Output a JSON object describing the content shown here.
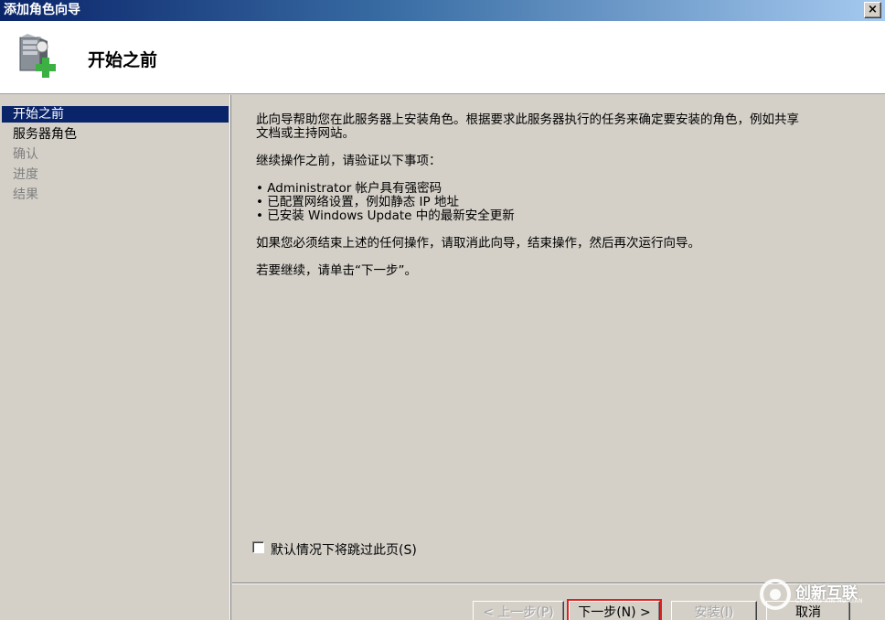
{
  "window": {
    "title": "添加角色向导",
    "close_label": "×"
  },
  "header": {
    "title": "开始之前",
    "icon": "server-add-icon"
  },
  "sidebar": {
    "items": [
      {
        "label": "开始之前",
        "state": "active"
      },
      {
        "label": "服务器角色",
        "state": "enabled"
      },
      {
        "label": "确认",
        "state": "disabled"
      },
      {
        "label": "进度",
        "state": "disabled"
      },
      {
        "label": "结果",
        "state": "disabled"
      }
    ]
  },
  "content": {
    "intro_line1": "此向导帮助您在此服务器上安装角色。根据要求此服务器执行的任务来确定要安装的角色，例如共享",
    "intro_line2": "文档或主持网站。",
    "verify_heading": "继续操作之前，请验证以下事项：",
    "bullets": [
      "• Administrator 帐户具有强密码",
      "• 已配置网络设置，例如静态 IP 地址",
      "• 已安装 Windows Update 中的最新安全更新"
    ],
    "cancel_note": "如果您必须结束上述的任何操作，请取消此向导，结束操作，然后再次运行向导。",
    "continue_note": "若要继续，请单击“下一步”。",
    "skip_checkbox_label": "默认情况下将跳过此页(S)"
  },
  "buttons": {
    "prev": "< 上一步(P)",
    "next": "下一步(N) >",
    "install": "安装(I)",
    "cancel": "取消"
  },
  "watermark": {
    "brand": "创新互联",
    "sub": "CHUANG XIN HU LIAN"
  },
  "colors": {
    "titlebar_start": "#0a246a",
    "titlebar_end": "#a6caf0",
    "selection": "#0a246a",
    "next_highlight": "#e02020"
  }
}
